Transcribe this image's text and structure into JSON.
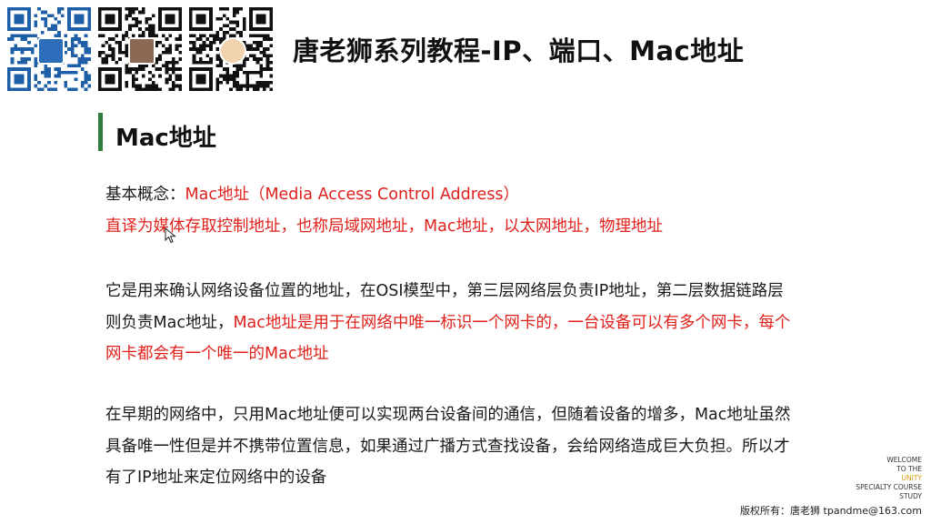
{
  "header": {
    "title": "唐老狮系列教程-IP、端口、Mac地址"
  },
  "section": {
    "title": "Mac地址"
  },
  "content": {
    "p1_line1_label": "基本概念：",
    "p1_line1_red": "Mac地址（Media Access Control Address）",
    "p1_line2_red": "直译为媒体存取控制地址，也称局域网地址，Mac地址，以太网地址，物理地址",
    "p2_line1": "它是用来确认网络设备位置的地址，在OSI模型中，第三层网络层负责IP地址，第二层数据链路层",
    "p2_line2_black": "则负责Mac地址，",
    "p2_line2_red": "Mac地址是用于在网络中唯一标识一个网卡的，一台设备可以有多个网卡，每个",
    "p2_line3_red": "网卡都会有一个唯一的Mac地址",
    "p3_line1": "在早期的网络中，只用Mac地址便可以实现两台设备间的通信，但随着设备的增多，Mac地址虽然",
    "p3_line2": "具备唯一性但是并不携带位置信息，如果通过广播方式查找设备，会给网络造成巨大负担。所以才",
    "p3_line3": "有了IP地址来定位网络中的设备"
  },
  "watermark": {
    "line1": "WELCOME",
    "line2": "TO THE",
    "line3": "UNITY",
    "line4": "SPECIALTY COURSE",
    "line5": "STUDY"
  },
  "footer": {
    "copyright": "版权所有：唐老狮 tpandme@163.com"
  },
  "icons": {
    "qr1": "qr-code-icon",
    "qr2": "qr-code-icon",
    "qr3": "qr-code-icon",
    "cursor": "mouse-cursor-icon"
  },
  "colors": {
    "accent_green": "#2f7d3c",
    "highlight_red": "#e0201b",
    "qr1": "#1f5fa8",
    "qr2": "#111111",
    "qr3": "#111111"
  }
}
